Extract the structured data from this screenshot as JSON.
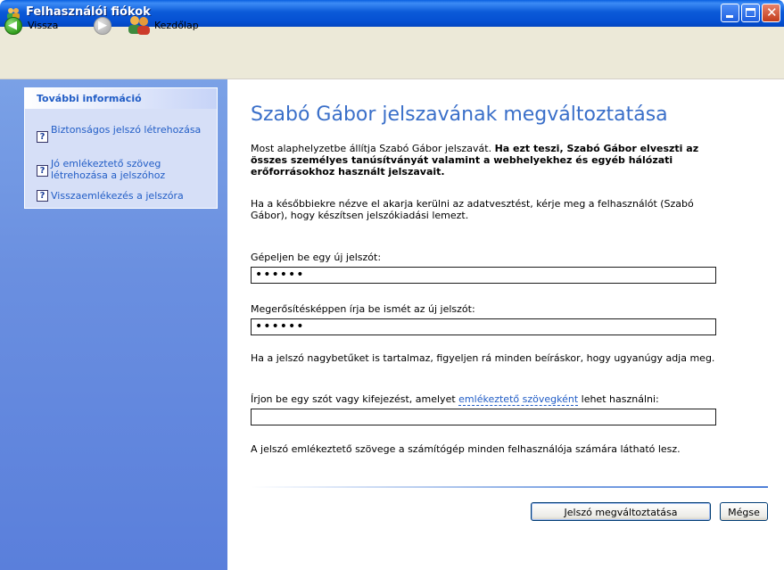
{
  "window": {
    "title": "Felhasználói fiókok"
  },
  "toolbar": {
    "back_label": "Vissza",
    "home_label": "Kezdőlap"
  },
  "sidebar": {
    "panel_title": "További információ",
    "items": [
      {
        "label": "Biztonságos jelszó létrehozása"
      },
      {
        "label": "Jó emlékeztető szöveg létrehozása a jelszóhoz"
      },
      {
        "label": "Visszaemlékezés a jelszóra"
      }
    ]
  },
  "main": {
    "heading": "Szabó Gábor jelszavának megváltoztatása",
    "intro_plain": "Most alaphelyzetbe állítja Szabó Gábor jelszavát. ",
    "intro_bold": "Ha ezt teszi, Szabó Gábor elveszti az összes személyes tanúsítványát valamint a webhelyekhez és egyéb hálózati erőforrásokhoz használt jelszavait.",
    "advice": "Ha a későbbiekre nézve el akarja kerülni az adatvesztést, kérje meg a felhasználót (Szabó Gábor), hogy készítsen jelszókiadási lemezt.",
    "new_password_label": "Gépeljen be egy új jelszót:",
    "new_password_value": "••••••",
    "confirm_label": "Megerősítésképpen írja be ismét az új jelszót:",
    "confirm_value": "••••••",
    "case_note": "Ha a jelszó nagybetűket is tartalmaz, figyeljen rá minden beíráskor, hogy ugyanúgy adja meg.",
    "hint_label_pre": "Írjon be egy szót vagy kifejezést, amelyet ",
    "hint_label_link": "emlékeztető szövegként",
    "hint_label_post": " lehet használni:",
    "hint_value": "",
    "visibility_note": "A jelszó emlékeztető szövege a számítógép minden felhasználója számára látható lesz.",
    "submit_label": "Jelszó megváltoztatása",
    "cancel_label": "Mégse"
  },
  "colors": {
    "titlebar": "#0b5ad8",
    "taskpane": "#6a8fe0",
    "heading": "#3a6fc9",
    "link": "#215dc6"
  },
  "icons": [
    "users-icon",
    "back-arrow-icon",
    "forward-arrow-icon",
    "home-users-icon",
    "help-icon",
    "minimize-icon",
    "maximize-icon",
    "close-icon"
  ]
}
